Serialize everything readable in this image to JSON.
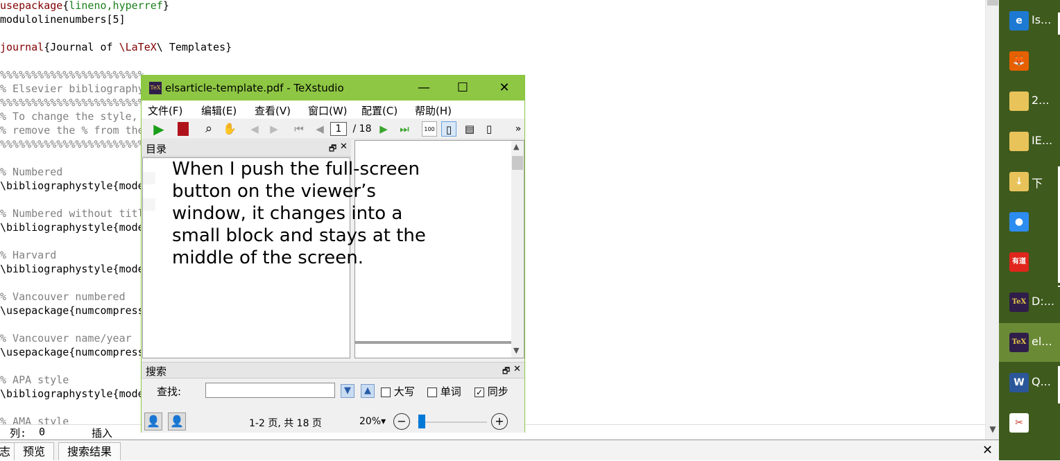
{
  "editor": {
    "lines": [
      {
        "kind": "code",
        "prefix": "usepackage",
        "arg": "lineno,hyperref"
      },
      {
        "kind": "plain",
        "text": "modulolinenumbers[5]"
      },
      {
        "kind": "plain",
        "text": ""
      },
      {
        "kind": "journal",
        "text": "journal",
        "arg": "Journal of ",
        "cmd": "\\LaTeX",
        "rest": "\\ Templates"
      },
      {
        "kind": "plain",
        "text": ""
      },
      {
        "kind": "comment",
        "text": "%%%%%%%%%%%%%%%%%%%%%%%"
      },
      {
        "kind": "comment",
        "text": "% Elsevier bibliography"
      },
      {
        "kind": "comment",
        "text": "%%%%%%%%%%%%%%%%%%%%%%%"
      },
      {
        "kind": "comment",
        "text": "% To change the style,"
      },
      {
        "kind": "comment",
        "text": "% remove the % from the"
      },
      {
        "kind": "comment",
        "text": "%%%%%%%%%%%%%%%%%%%%%%%"
      },
      {
        "kind": "plain",
        "text": ""
      },
      {
        "kind": "comment",
        "text": "% Numbered"
      },
      {
        "kind": "plain",
        "text": "\\bibliographystyle{mode"
      },
      {
        "kind": "plain",
        "text": ""
      },
      {
        "kind": "comment",
        "text": "% Numbered without titl"
      },
      {
        "kind": "plain",
        "text": "\\bibliographystyle{mode"
      },
      {
        "kind": "plain",
        "text": ""
      },
      {
        "kind": "comment",
        "text": "% Harvard"
      },
      {
        "kind": "plain",
        "text": "\\bibliographystyle{mode"
      },
      {
        "kind": "plain",
        "text": ""
      },
      {
        "kind": "comment",
        "text": "% Vancouver numbered"
      },
      {
        "kind": "plain",
        "text": "\\usepackage{numcompress"
      },
      {
        "kind": "plain",
        "text": ""
      },
      {
        "kind": "comment",
        "text": "% Vancouver name/year"
      },
      {
        "kind": "plain",
        "text": "\\usepackage{numcompress"
      },
      {
        "kind": "plain",
        "text": ""
      },
      {
        "kind": "comment",
        "text": "% APA style"
      },
      {
        "kind": "plain",
        "text": "\\bibliographystyle{mode"
      },
      {
        "kind": "plain",
        "text": ""
      },
      {
        "kind": "comment",
        "text": "% AMA style"
      }
    ]
  },
  "status": {
    "col_label": "列:",
    "col_value": "0",
    "mode": "插入"
  },
  "bottom_tabs": [
    "志",
    "预览",
    "搜索结果"
  ],
  "pdf_window": {
    "title": "elsarticle-template.pdf - TeXstudio",
    "logo": "TeX",
    "menus": [
      "文件(F)",
      "编辑(E)",
      "查看(V)",
      "窗口(W)",
      "配置(C)",
      "帮助(H)"
    ],
    "page_current": "1",
    "page_total": "/ 18",
    "toc_title": "目录",
    "search_title": "搜索",
    "find_label": "查找:",
    "find_value": "",
    "options": [
      {
        "label": "大写",
        "checked": false
      },
      {
        "label": "单词",
        "checked": false
      },
      {
        "label": "同步",
        "checked": true
      }
    ],
    "page_info": "1-2 页, 共 18 页",
    "zoom": "20%"
  },
  "overlay_text": "When I push the full-screen button on the viewer’s window, it changes into a small block and stays at the middle of the screen.",
  "taskbar": [
    {
      "icon": "edge-icon",
      "label": "Is...",
      "color": "#1e79d3",
      "glyph": "e",
      "active": false
    },
    {
      "icon": "firefox-icon",
      "label": "",
      "color": "#e66000",
      "glyph": "🦊",
      "active": false
    },
    {
      "icon": "folder-icon",
      "label": "2...",
      "color": "#e8c35a",
      "glyph": "",
      "active": false
    },
    {
      "icon": "folder-icon",
      "label": "IE...",
      "color": "#e8c35a",
      "glyph": "",
      "active": false
    },
    {
      "icon": "downloads-folder-icon",
      "label": "下",
      "color": "#e8c35a",
      "glyph": "↓",
      "active": false
    },
    {
      "icon": "app-blue-icon",
      "label": "",
      "color": "#2d8cf0",
      "glyph": "●",
      "active": false
    },
    {
      "icon": "youdao-icon",
      "label": "",
      "color": "#e0261c",
      "glyph": "有道",
      "active": false
    },
    {
      "icon": "texstudio-icon",
      "label": "D:...",
      "color": "#2f1e4a",
      "glyph": "TeX",
      "active": false
    },
    {
      "icon": "texstudio-icon",
      "label": "el...",
      "color": "#2f1e4a",
      "glyph": "TeX",
      "active": true
    },
    {
      "icon": "word-icon",
      "label": "Q...",
      "color": "#2b579a",
      "glyph": "W",
      "active": false
    },
    {
      "icon": "snipping-tool-icon",
      "label": "",
      "color": "#e9e9e9",
      "glyph": "✂",
      "active": false
    }
  ],
  "colors": {
    "window_border": "#89c743",
    "taskbar_bg": "#3e5a1d",
    "taskbar_active": "#6b8a36",
    "keyword": "#800000",
    "argument": "#1a7f1a",
    "comment": "#808080"
  }
}
